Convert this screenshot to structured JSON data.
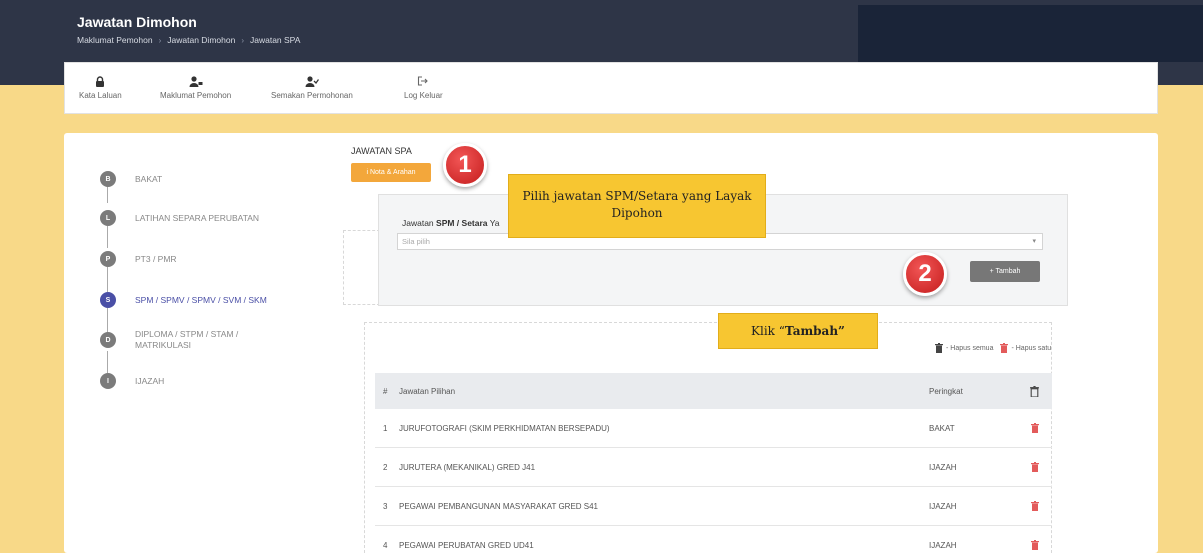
{
  "header": {
    "title": "Jawatan Dimohon",
    "breadcrumbs": [
      "Maklumat Pemohon",
      "Jawatan Dimohon",
      "Jawatan SPA"
    ]
  },
  "menu": [
    {
      "label": "Kata Laluan",
      "icon": "lock-icon"
    },
    {
      "label": "Maklumat Pemohon",
      "icon": "user-card-icon"
    },
    {
      "label": "Semakan Permohonan",
      "icon": "user-check-icon"
    },
    {
      "label": "Log Keluar",
      "icon": "logout-icon"
    }
  ],
  "steps": [
    {
      "letter": "B",
      "label": "BAKAT"
    },
    {
      "letter": "L",
      "label": "LATIHAN SEPARA PERUBATAN"
    },
    {
      "letter": "P",
      "label": "PT3 / PMR"
    },
    {
      "letter": "S",
      "label": "SPM / SPMV / SPMV / SVM / SKM"
    },
    {
      "letter": "D",
      "label": "DIPLOMA / STPM / STAM / MATRIKULASI"
    },
    {
      "letter": "I",
      "label": "IJAZAH"
    }
  ],
  "section": {
    "title": "JAWATAN SPA",
    "nota_button": "i Nota & Arahan",
    "field_label_prefix": "Jawatan ",
    "field_label_bold": "SPM / Setara",
    "field_label_suffix": " Ya",
    "select_placeholder": "Sila pilih",
    "tambah_button": "+ Tambah"
  },
  "callouts": {
    "pilih": "Pilih jawatan SPM/Setara yang Layak Dipohon",
    "klik_prefix": "Klik “",
    "klik_bold": "Tambah”"
  },
  "badges": {
    "one": "1",
    "two": "2"
  },
  "hapus": {
    "all": "- Hapus semua",
    "one": "- Hapus satu"
  },
  "table": {
    "headers": {
      "num": "#",
      "name": "Jawatan Pilihan",
      "rank": "Peringkat"
    },
    "rows": [
      {
        "num": "1",
        "name": "JURUFOTOGRAFI (SKIM PERKHIDMATAN BERSEPADU)",
        "rank": "BAKAT"
      },
      {
        "num": "2",
        "name": "JURUTERA (MEKANIKAL) GRED J41",
        "rank": "IJAZAH"
      },
      {
        "num": "3",
        "name": "PEGAWAI PEMBANGUNAN MASYARAKAT GRED S41",
        "rank": "IJAZAH"
      },
      {
        "num": "4",
        "name": "PEGAWAI PERUBATAN GRED UD41",
        "rank": "IJAZAH"
      }
    ]
  },
  "colors": {
    "accent": "#4a4fa6",
    "nota": "#f3a73b",
    "delete": "#e35b5b",
    "callout": "#f7c631"
  }
}
